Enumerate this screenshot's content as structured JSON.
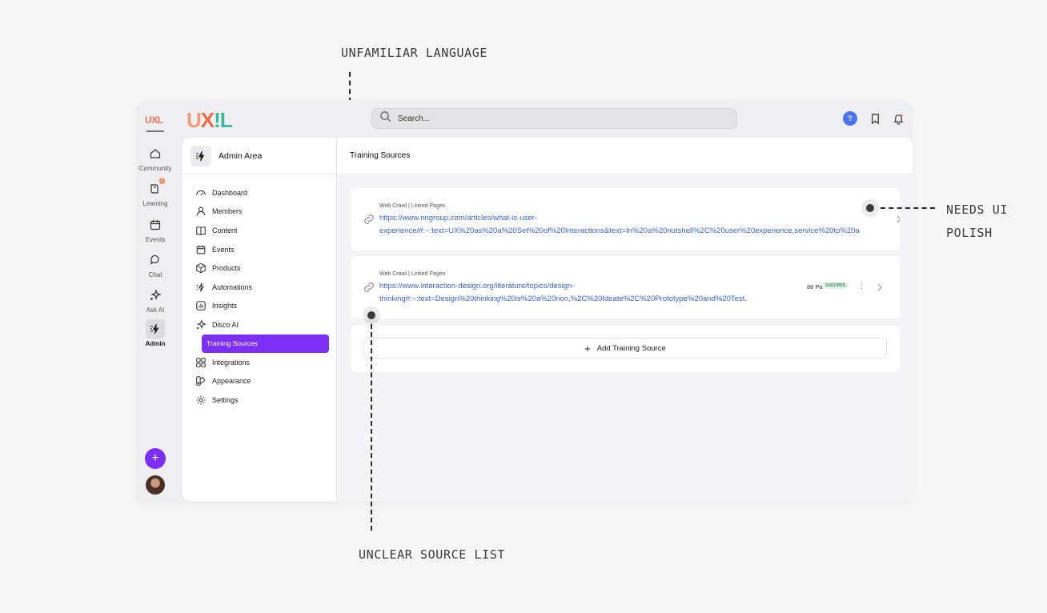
{
  "annotations": {
    "top": "UNFAMILIAR LANGUAGE",
    "right_line1": "NEEDS UI",
    "right_line2": "POLISH",
    "bottom": "UNCLEAR SOURCE LIST"
  },
  "brand": {
    "rail_logo": "UXL",
    "logo": [
      "U",
      "X",
      "!L"
    ]
  },
  "search": {
    "placeholder": "Search..."
  },
  "topbar": {
    "help_label": "?"
  },
  "rail": [
    {
      "label": "Community",
      "icon": "home-icon"
    },
    {
      "label": "Learning",
      "icon": "book-icon",
      "badge": "2"
    },
    {
      "label": "Events",
      "icon": "calendar-icon"
    },
    {
      "label": "Chat",
      "icon": "chat-icon"
    },
    {
      "label": "Ask AI",
      "icon": "sparkle-icon"
    },
    {
      "label": "Admin",
      "icon": "admin-icon",
      "active": true
    }
  ],
  "admin": {
    "title": "Admin Area",
    "nav": [
      {
        "label": "Dashboard",
        "icon": "gauge-icon"
      },
      {
        "label": "Members",
        "icon": "user-icon"
      },
      {
        "label": "Content",
        "icon": "book-open-icon"
      },
      {
        "label": "Events",
        "icon": "calendar-icon"
      },
      {
        "label": "Products",
        "icon": "box-icon"
      },
      {
        "label": "Automations",
        "icon": "bolt-icon"
      },
      {
        "label": "Insights",
        "icon": "chart-icon"
      },
      {
        "label": "Disco AI",
        "icon": "sparkle-icon"
      },
      {
        "label": "Training Sources",
        "sub": true,
        "active": true
      },
      {
        "label": "Integrations",
        "icon": "grid-icon"
      },
      {
        "label": "Appearance",
        "icon": "palette-icon"
      },
      {
        "label": "Settings",
        "icon": "gear-icon"
      }
    ]
  },
  "main": {
    "title": "Training Sources",
    "sources": [
      {
        "type": "Web Crawl | Linked Pages",
        "line1": "https://www.nngroup.com/articles/what-is-user-",
        "line2": "experience/#:~:text=UX%20as%20a%20Set%20of%20Interactions&text=In%20a%20nutshell%2C%20user%20experience,service%20to%20a"
      },
      {
        "type": "Web Crawl | Linked Pages",
        "line1": "https://www.interaction-design.org/literature/topics/design-",
        "line2": "thinking#:~:text=Design%20thinking%20is%20a%20non,%2C%20Ideate%2C%20Prototype%20and%20Test.",
        "pages": "88 Pa",
        "status": "success"
      }
    ],
    "add_label": "Add Training Source"
  }
}
